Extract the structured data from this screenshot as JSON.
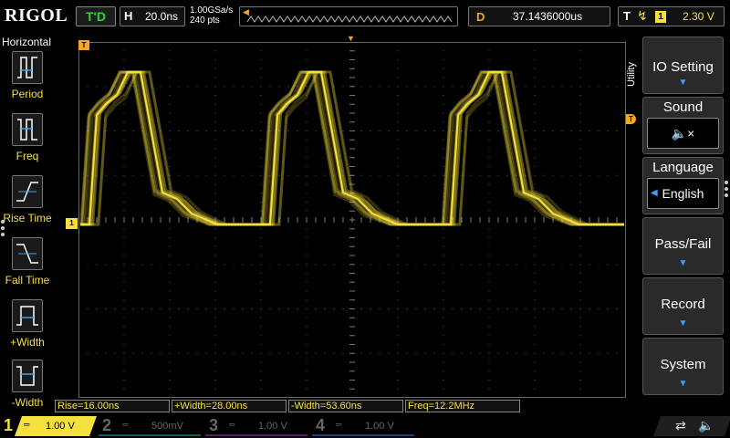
{
  "brand": "RIGOL",
  "trigger_status": "T'D",
  "horizontal": {
    "label": "H",
    "timebase": "20.0ns"
  },
  "acquisition": {
    "sample_rate": "1.00GSa/s",
    "memory_depth": "240  pts"
  },
  "delay": {
    "label": "D",
    "value": "37.1436000us"
  },
  "trigger": {
    "label": "T",
    "edge_icon": "rising-edge-icon",
    "source": "1",
    "level": "2.30 V"
  },
  "left_menu": {
    "title": "Horizontal",
    "items": [
      {
        "label": "Period",
        "icon": "period-icon"
      },
      {
        "label": "Freq",
        "icon": "frequency-icon"
      },
      {
        "label": "Rise Time",
        "icon": "rise-time-icon"
      },
      {
        "label": "Fall Time",
        "icon": "fall-time-icon"
      },
      {
        "label": "+Width",
        "icon": "positive-width-icon"
      },
      {
        "label": "-Width",
        "icon": "negative-width-icon"
      }
    ]
  },
  "markers": {
    "trigger_time": "T",
    "channel1": "1",
    "trigger_level": "T"
  },
  "right_menu": {
    "side_label": "Utility",
    "io_setting": "IO Setting",
    "sound": "Sound",
    "sound_icon": "speaker-muted-icon",
    "language": "Language",
    "language_value": "English",
    "pass_fail": "Pass/Fail",
    "record": "Record",
    "system": "System"
  },
  "measurements": {
    "rise": "Rise=16.00ns",
    "pos_width": "+Width=28.00ns",
    "neg_width": "-Width=53.60ns",
    "freq": "Freq=12.2MHz"
  },
  "channels": [
    {
      "num": "1",
      "coupling": "═",
      "scale": "1.00 V",
      "color": "#f5e03c",
      "active": true
    },
    {
      "num": "2",
      "coupling": "═",
      "scale": "500mV",
      "color": "#0b9e8e",
      "active": false
    },
    {
      "num": "3",
      "coupling": "═",
      "scale": "1.00 V",
      "color": "#a33aa3",
      "active": false
    },
    {
      "num": "4",
      "coupling": "═",
      "scale": "1.00 V",
      "color": "#2f6fd0",
      "active": false
    }
  ],
  "status_icons": [
    "usb-icon",
    "speaker-muted-icon"
  ],
  "colors": {
    "ch1": "#f5e03c",
    "trigger": "#f5a623",
    "trig_status": "#2fd12f",
    "accent": "#3fa0ff"
  }
}
